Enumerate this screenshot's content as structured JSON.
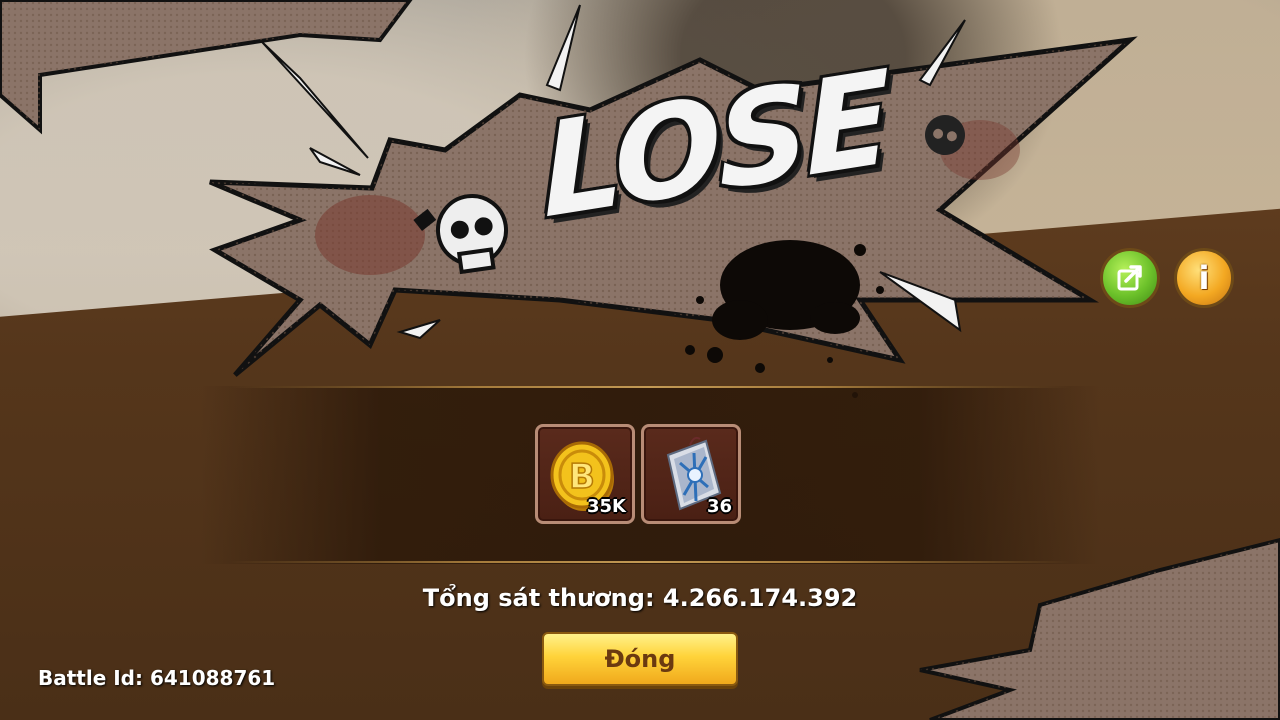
{
  "result": {
    "title": "LOSE"
  },
  "rewards": [
    {
      "icon": "gold-coin-icon",
      "quantity": "35K"
    },
    {
      "icon": "crystal-scroll-icon",
      "quantity": "36"
    }
  ],
  "summary": {
    "damage_text": "Tổng sát thương: 4.266.174.392"
  },
  "actions": {
    "close_label": "Đóng",
    "info_label": "i"
  },
  "footer": {
    "battle_id": "Battle Id: 641088761"
  },
  "colors": {
    "accent_gold": "#ffd33a",
    "share_green": "#6cc12a",
    "info_orange": "#f3a822",
    "panel_brown": "#55361b"
  }
}
